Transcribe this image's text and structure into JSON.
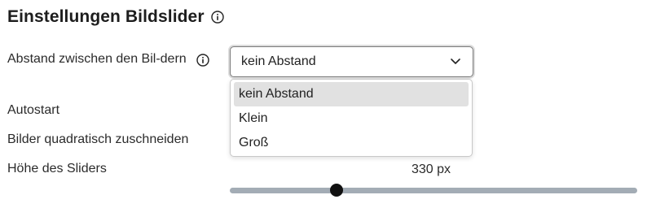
{
  "section": {
    "title": "Einstellungen Bildslider",
    "info_icon": "info-circle-icon"
  },
  "settings": {
    "spacing_label": "Abstand zwischen den Bil-dern",
    "autostart_label": "Autostart",
    "crop_square_label": "Bilder quadratisch zuschneiden",
    "slider_height_label": "Höhe des Sliders"
  },
  "spacing_select": {
    "selected_value": "kein Abstand",
    "options": [
      "kein Abstand",
      "Klein",
      "Groß"
    ],
    "highlighted_index": 0,
    "icon": "chevron-down-icon"
  },
  "slider_height": {
    "value_text": "330 px",
    "fraction": 0.262
  },
  "colors": {
    "slider_track": "#a3acb5",
    "slider_thumb": "#111111",
    "option_highlight": "#e1e1e1"
  }
}
